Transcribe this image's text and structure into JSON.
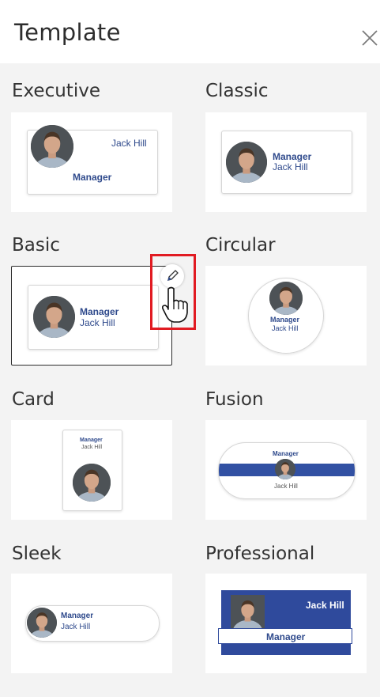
{
  "header": {
    "title": "Template"
  },
  "person": {
    "name": "Jack Hill",
    "role": "Manager"
  },
  "templates": [
    {
      "label": "Executive"
    },
    {
      "label": "Classic"
    },
    {
      "label": "Basic"
    },
    {
      "label": "Circular"
    },
    {
      "label": "Card"
    },
    {
      "label": "Fusion"
    },
    {
      "label": "Sleek"
    },
    {
      "label": "Professional"
    }
  ],
  "colors": {
    "brand_blue": "#2f4a8c",
    "fusion_band": "#3251a3",
    "highlight": "#e11b22"
  },
  "icons": [
    "close-icon",
    "pencil-icon",
    "hand-cursor-icon"
  ],
  "state": {
    "hovered_template": "Basic"
  }
}
